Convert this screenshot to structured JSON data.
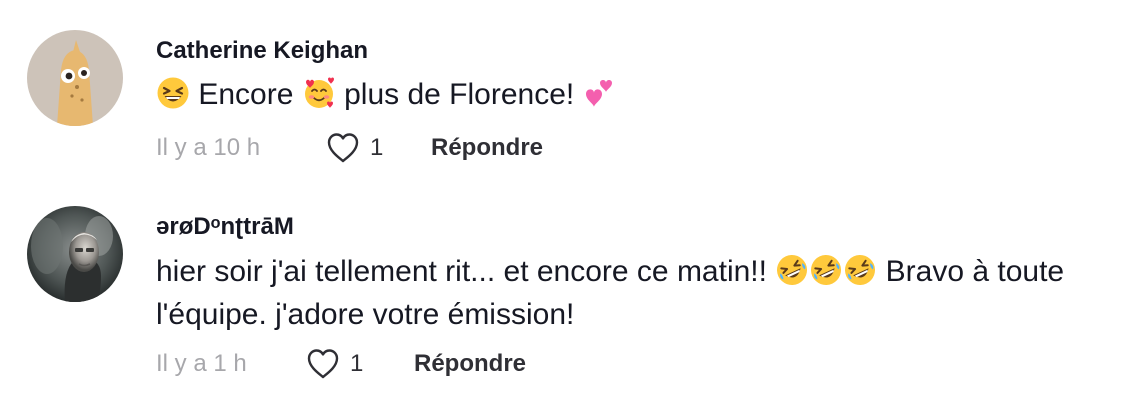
{
  "comments": [
    {
      "username": "Catherine Keighan",
      "avatar_icon": "cartoon-creature-avatar",
      "text_parts": [
        "Encore",
        "plus de Florence!"
      ],
      "emojis": [
        "grinning-squinting-face-emoji",
        "smiling-face-with-hearts-emoji",
        "two-hearts-emoji"
      ],
      "timestamp": "Il y a 10 h",
      "like_count": "1",
      "like_icon": "heart-outline-icon",
      "reply_label": "Répondre"
    },
    {
      "username": "ərøDᵒnʈtrāM",
      "avatar_icon": "photo-portrait-avatar",
      "text_parts": [
        "hier soir j'ai tellement rit... et encore ce matin!!",
        "Bravo à toute l'équipe. j'adore votre émission!"
      ],
      "emojis": [
        "rolling-on-floor-laughing-emoji",
        "rolling-on-floor-laughing-emoji",
        "rolling-on-floor-laughing-emoji"
      ],
      "timestamp": "Il y a 1 h",
      "like_count": "1",
      "like_icon": "heart-outline-icon",
      "reply_label": "Répondre"
    }
  ],
  "colors": {
    "text": "#161823",
    "muted": "#a7a7ab",
    "action": "#2f2f35",
    "avatar_bg": "#cdc3b9",
    "creature": "#e7b870"
  }
}
